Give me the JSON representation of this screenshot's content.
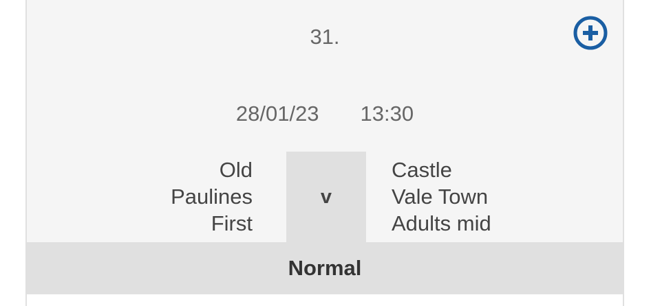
{
  "fixture": {
    "number": "31.",
    "date": "28/01/23",
    "time": "13:30",
    "home_team": [
      "Old",
      "Paulines",
      "First"
    ],
    "vs": "v",
    "away_team": [
      "Castle",
      "Vale Town",
      "Adults mid"
    ],
    "status": "Normal"
  },
  "icons": {
    "add": "plus-circle-icon"
  },
  "colors": {
    "accent": "#1a5ea3",
    "card_bg": "#f5f5f5",
    "band_bg": "#e0e0e0"
  }
}
